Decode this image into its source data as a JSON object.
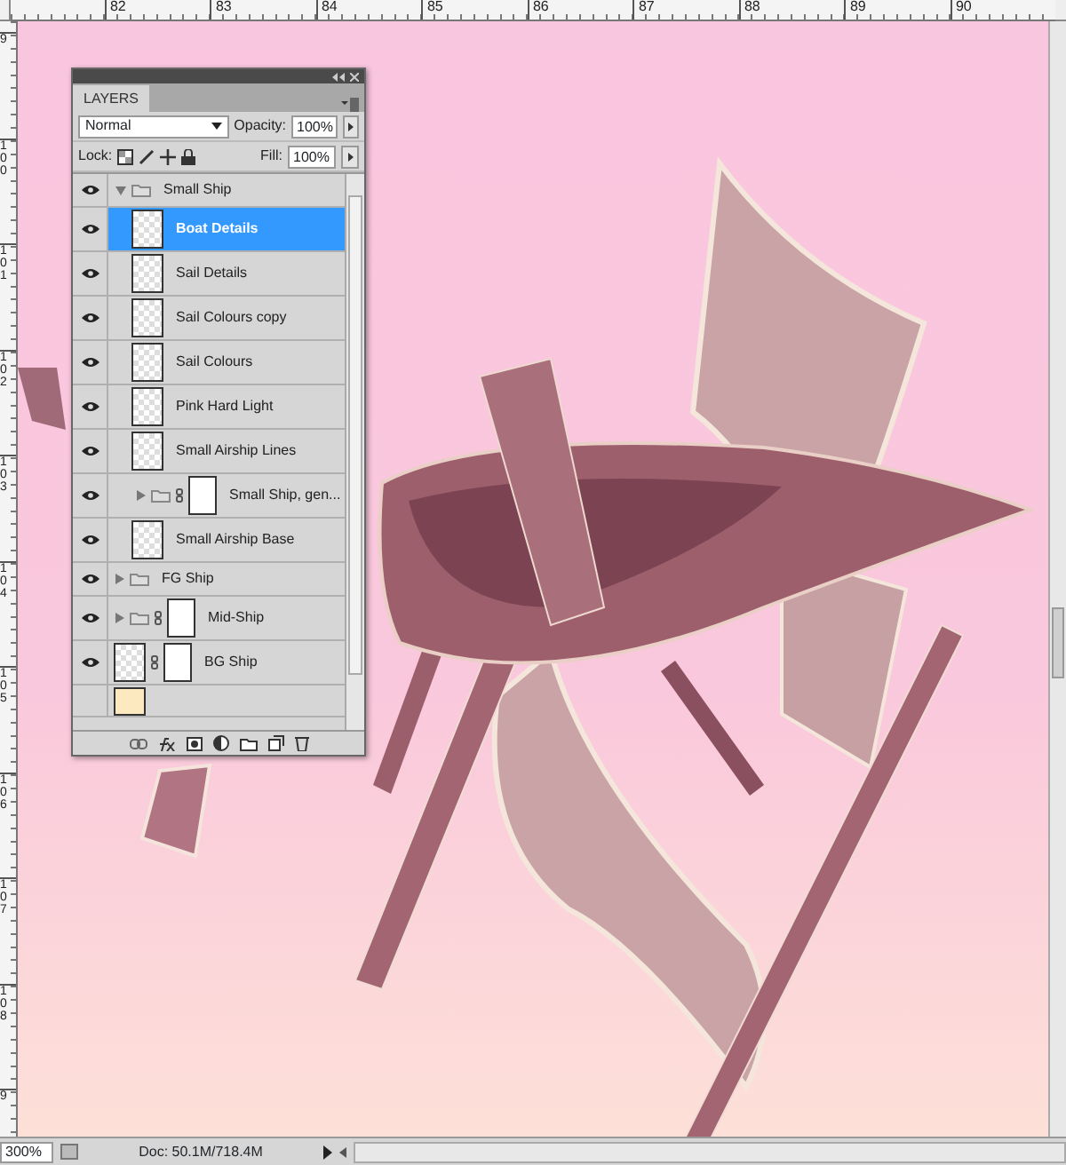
{
  "rulers": {
    "horizontal": [
      "82",
      "83",
      "84",
      "85",
      "86",
      "87",
      "88",
      "89",
      "90"
    ],
    "vertical": [
      "9",
      "100",
      "101",
      "102",
      "103",
      "104",
      "105",
      "106",
      "107",
      "108",
      "9"
    ]
  },
  "layers_panel": {
    "title": "LAYERS",
    "blend_mode": "Normal",
    "opacity_label": "Opacity:",
    "opacity": "100%",
    "lock_label": "Lock:",
    "fill_label": "Fill:",
    "fill": "100%",
    "layers": [
      {
        "kind": "group",
        "name": "Small Ship",
        "visible": true,
        "expanded": true,
        "selected": false,
        "children": [
          {
            "kind": "layer",
            "name": "Boat Details",
            "visible": true,
            "selected": true
          },
          {
            "kind": "layer",
            "name": "Sail Details",
            "visible": true,
            "selected": false
          },
          {
            "kind": "layer",
            "name": "Sail Colours copy",
            "visible": true,
            "selected": false
          },
          {
            "kind": "layer",
            "name": "Sail Colours",
            "visible": true,
            "selected": false
          },
          {
            "kind": "layer",
            "name": "Pink Hard Light",
            "visible": true,
            "selected": false
          },
          {
            "kind": "layer",
            "name": "Small Airship Lines",
            "visible": true,
            "selected": false
          },
          {
            "kind": "group",
            "name": "Small Ship, gen...",
            "visible": true,
            "expanded": false,
            "masked": true,
            "selected": false
          },
          {
            "kind": "layer",
            "name": "Small Airship Base",
            "visible": true,
            "selected": false
          }
        ]
      },
      {
        "kind": "group",
        "name": "FG Ship",
        "visible": true,
        "expanded": false,
        "selected": false
      },
      {
        "kind": "group",
        "name": "Mid-Ship",
        "visible": true,
        "expanded": false,
        "masked": true,
        "selected": false
      },
      {
        "kind": "layer",
        "name": "BG Ship",
        "visible": true,
        "masked": true,
        "selected": false
      },
      {
        "kind": "fill-layer",
        "visible": false,
        "selected": false
      }
    ]
  },
  "status_bar": {
    "zoom": "300%",
    "doc": "Doc: 50.1M/718.4M"
  }
}
